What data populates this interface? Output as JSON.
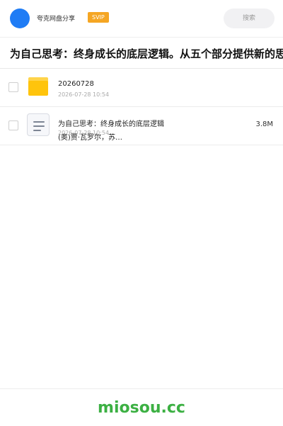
{
  "header": {
    "brand": "夸克网盘分享",
    "badge": "SVIP",
    "search_label": "搜索"
  },
  "page_title": "为自己思考：终身成长的底层逻辑。从五个部分提供新的思",
  "files": [
    {
      "icon": "folder-icon",
      "name": "20260728",
      "date": "2026-07-28 10:54",
      "size": ""
    },
    {
      "icon": "document-icon",
      "name": "为自己思考：终身成长的底层逻辑",
      "name_line2": "(奥)贾·瓦罗尔，苏…",
      "date": "2026-07-28 10:54",
      "size": "3.8M"
    }
  ],
  "footer": {
    "site": "miosou.cc"
  },
  "colors": {
    "avatar": "#1f7cf5",
    "badge": "#f5a623",
    "folder": "#ffc40c",
    "site": "#3cb043"
  }
}
